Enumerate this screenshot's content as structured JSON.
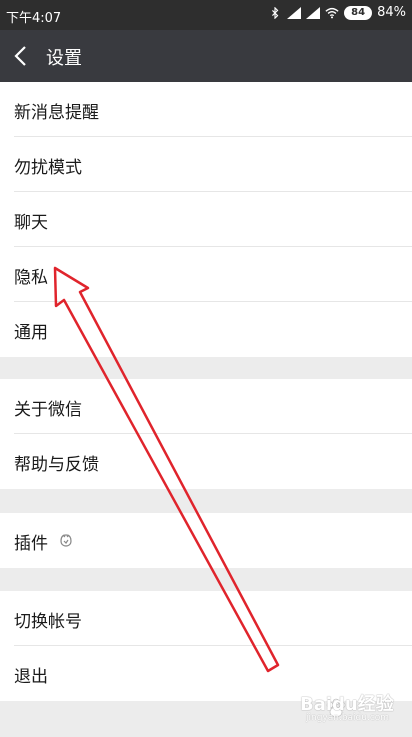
{
  "status": {
    "time": "下午4:07",
    "battery": "84%"
  },
  "header": {
    "title": "设置"
  },
  "groups": [
    {
      "items": [
        "新消息提醒",
        "勿扰模式",
        "聊天",
        "隐私",
        "通用"
      ]
    },
    {
      "items": [
        "关于微信",
        "帮助与反馈"
      ]
    },
    {
      "items": [
        "插件"
      ]
    },
    {
      "items": [
        "切换帐号",
        "退出"
      ]
    }
  ],
  "watermark": {
    "brand": "Baidu经验",
    "url": "jingyan.baidu.com"
  },
  "colors": {
    "navbar": "#393a3f",
    "statusbar": "#2e2e2e",
    "background": "#ececec",
    "arrow": "#e0242c"
  }
}
